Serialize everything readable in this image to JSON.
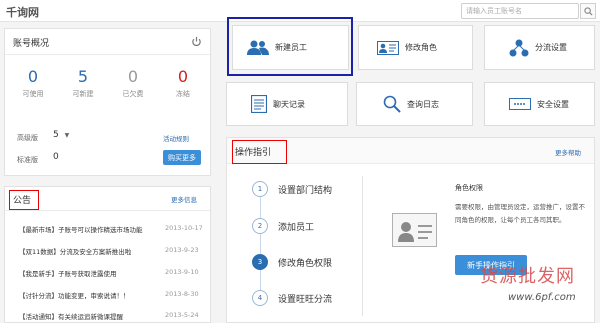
{
  "brand": "千询网",
  "search": {
    "placeholder": "请输入员工账号名"
  },
  "account": {
    "title": "账号概况",
    "stats": [
      {
        "value": "0",
        "label": "可使用",
        "color": "#2b6cb0"
      },
      {
        "value": "5",
        "label": "可新建",
        "color": "#2b6cb0"
      },
      {
        "value": "0",
        "label": "已欠费",
        "color": "#999999"
      },
      {
        "value": "0",
        "label": "冻结",
        "color": "#cc2222"
      }
    ],
    "pro_label": "高级版",
    "pro_value": "5",
    "std_label": "标准版",
    "std_value": "0",
    "rules_link": "活动规则",
    "buy_button": "购买更多"
  },
  "tiles": [
    {
      "label": "新建员工",
      "icon": "users-icon"
    },
    {
      "label": "修改角色",
      "icon": "id-card-icon"
    },
    {
      "label": "分流设置",
      "icon": "network-icon"
    },
    {
      "label": "聊天记录",
      "icon": "document-icon"
    },
    {
      "label": "查询日志",
      "icon": "search-icon"
    },
    {
      "label": "安全设置",
      "icon": "dots-icon"
    }
  ],
  "guide": {
    "title": "操作指引",
    "more": "更多帮助",
    "steps": [
      {
        "num": "1",
        "label": "设置部门结构"
      },
      {
        "num": "2",
        "label": "添加员工"
      },
      {
        "num": "3",
        "label": "修改角色权限"
      },
      {
        "num": "4",
        "label": "设置旺旺分流"
      }
    ],
    "info_title": "角色权限",
    "info_text": "需要权限，由管理员设定，运营推广，设置不同角色的权限，让每个员工各司其职。",
    "start_button": "新手操作指引"
  },
  "notice": {
    "title": "公告",
    "more": "更多信息",
    "items": [
      {
        "text": "【最新市场】子账号可以操作精选市场功能",
        "date": "2013-10-17"
      },
      {
        "text": "【双11数据】分流及安全方案新推出啦",
        "date": "2013-9-23"
      },
      {
        "text": "【我是新手】子账号获取泄露使用",
        "date": "2013-9-10"
      },
      {
        "text": "【讨针分流】功能变更，审索说请！！",
        "date": "2013-8-30"
      },
      {
        "text": "【活动通知】有关续运追新微课提醒",
        "date": "2013-5-24"
      }
    ]
  },
  "watermark": {
    "line1": "货源批发网",
    "line2": "www.6pf.com"
  }
}
